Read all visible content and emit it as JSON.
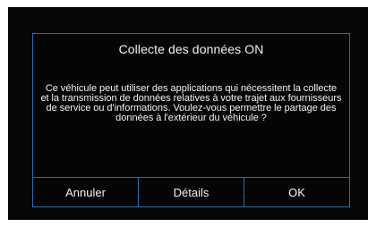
{
  "dialog": {
    "title": "Collecte des données ON",
    "message": "Ce véhicule peut utiliser des applications qui nécessitent la collecte et la transmission de données relatives à votre trajet aux fournisseurs de service ou d'informations. Voulez-vous permettre le partage des données à l'extérieur du véhicule ?",
    "buttons": {
      "cancel": "Annuler",
      "details": "Détails",
      "ok": "OK"
    }
  },
  "colors": {
    "screen_background": "#060606",
    "border_accent": "#2d6aa8",
    "text": "#f2f2f2"
  }
}
